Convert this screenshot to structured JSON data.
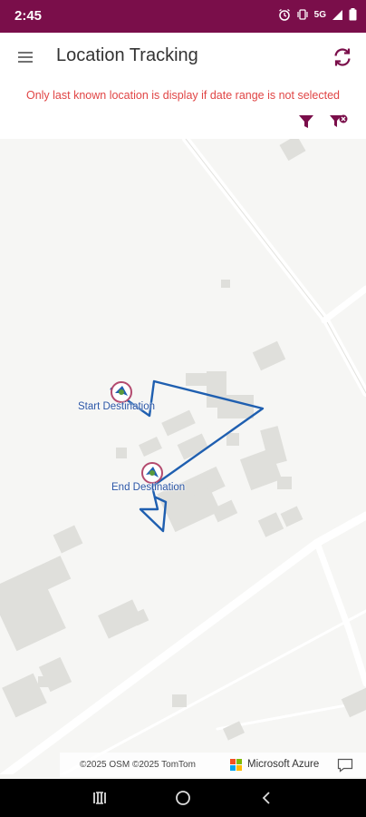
{
  "status_bar": {
    "time": "2:45",
    "icons": [
      "alarm-icon",
      "vibrate-icon",
      "5g-icon",
      "signal-icon",
      "battery-icon"
    ],
    "network_label": "5G"
  },
  "app_bar": {
    "title": "Location Tracking",
    "menu_icon": "hamburger-menu-icon",
    "refresh_icon": "refresh-icon"
  },
  "notice": {
    "text": "Only last known location is display if date range is not selected"
  },
  "filters": {
    "apply_icon": "filter-icon",
    "clear_icon": "filter-clear-icon"
  },
  "map": {
    "start_label": "Start Destination",
    "end_label": "End Destination",
    "route_color": "#1f5fb0"
  },
  "attribution": {
    "text": "©2025 OSM  ©2025 TomTom",
    "provider": "Microsoft Azure",
    "feedback_icon": "feedback-icon"
  },
  "colors": {
    "status_bar": "#7a0e4a",
    "accent": "#7a0e4a",
    "notice": "#e04545"
  },
  "nav_bar": {
    "icons": [
      "recent-apps-icon",
      "home-icon",
      "back-icon"
    ]
  }
}
